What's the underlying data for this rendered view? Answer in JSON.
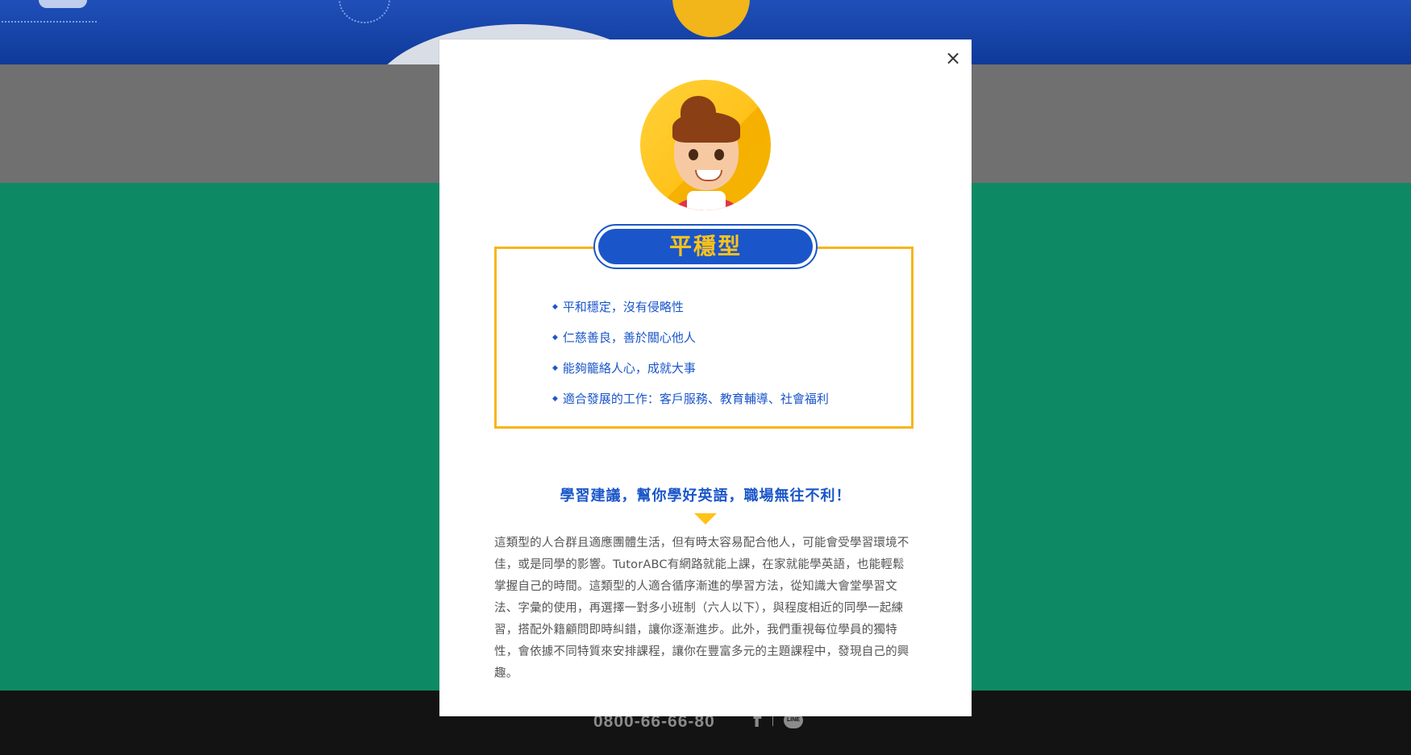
{
  "footer": {
    "phone": "0800-66-66-80",
    "facebook_icon": "f",
    "line_icon": "LINE"
  },
  "modal": {
    "close_label": "×",
    "personality_type": "平穩型",
    "traits": [
      "平和穩定，沒有侵略性",
      "仁慈善良，善於關心他人",
      "能夠籠絡人心，成就大事",
      "適合發展的工作：客戶服務、教育輔導、社會福利"
    ],
    "advice_title": "學習建議，幫你學好英語，職場無往不利！",
    "advice_body": "這類型的人合群且適應團體生活，但有時太容易配合他人，可能會受學習環境不佳，或是同學的影響。TutorABC有網路就能上課，在家就能學英語，也能輕鬆掌握自己的時間。這類型的人適合循序漸進的學習方法，從知識大會堂學習文法、字彙的使用，再選擇一對多小班制（六人以下），與程度相近的同學一起練習，搭配外籍顧問即時糾錯，讓你逐漸進步。此外，我們重視每位學員的獨特性，會依據不同特質來安排課程，讓你在豐富多元的主題課程中，發現自己的興趣。"
  },
  "colors": {
    "accent_blue": "#1a56c9",
    "accent_yellow": "#ffc21a",
    "box_border": "#f7b51c",
    "bg_green": "#0d8a63"
  }
}
